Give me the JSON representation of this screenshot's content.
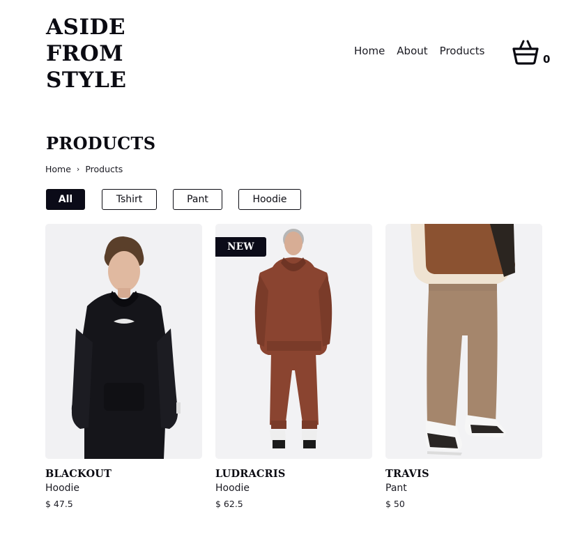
{
  "brand": {
    "lines": [
      "ASIDE",
      "FROM",
      "STYLE"
    ]
  },
  "nav": {
    "items": [
      "Home",
      "About",
      "Products"
    ]
  },
  "cart": {
    "icon": "basket-icon",
    "count": "0"
  },
  "page": {
    "title": "PRODUCTS"
  },
  "breadcrumb": {
    "items": [
      "Home",
      "Products"
    ],
    "separator": "›"
  },
  "filters": {
    "items": [
      "All",
      "Tshirt",
      "Pant",
      "Hoodie"
    ],
    "active": "All"
  },
  "products": [
    {
      "name": "BLACKOUT",
      "category": "Hoodie",
      "price": "$ 47.5",
      "badge": ""
    },
    {
      "name": "LUDRACRIS",
      "category": "Hoodie",
      "price": "$ 62.5",
      "badge": "NEW"
    },
    {
      "name": "TRAVIS",
      "category": "Pant",
      "price": "$ 50",
      "badge": ""
    }
  ],
  "colors": {
    "dark": "#0b0b18",
    "image_bg": "#f1f1f3",
    "hoodie_brown": "#8a4430",
    "pant_tan": "#a5866c"
  }
}
